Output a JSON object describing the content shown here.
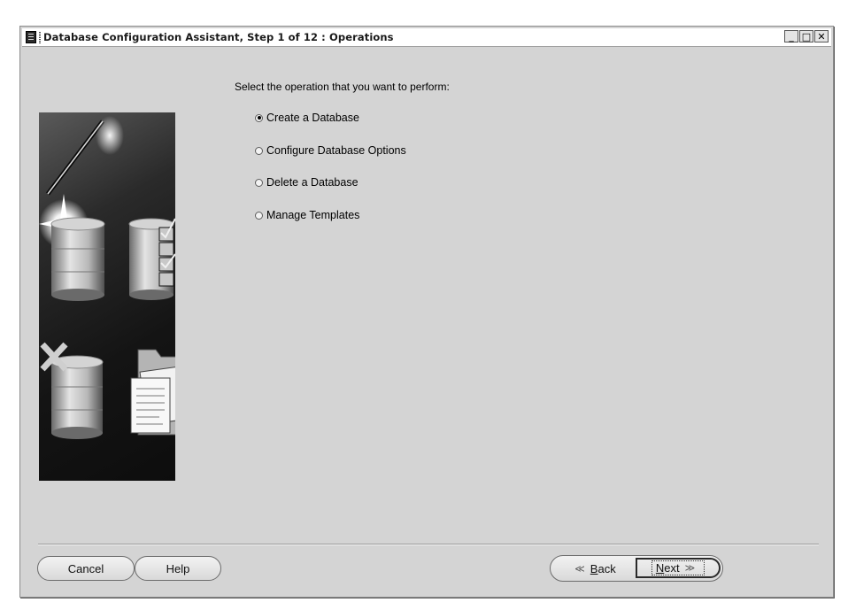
{
  "window": {
    "title": "Database Configuration Assistant, Step 1 of 12 : Operations",
    "controls": {
      "minimize": "_",
      "maximize": "□",
      "close": "✕"
    }
  },
  "main": {
    "prompt": "Select the operation that you want to perform:",
    "options": [
      {
        "label": "Create a Database",
        "selected": true
      },
      {
        "label": "Configure Database Options",
        "selected": false
      },
      {
        "label": "Delete a Database",
        "selected": false
      },
      {
        "label": "Manage Templates",
        "selected": false
      }
    ]
  },
  "buttons": {
    "cancel": "Cancel",
    "help": "Help",
    "back_mnemonic": "B",
    "back_rest": "ack",
    "next_mnemonic": "N",
    "next_rest": "ext"
  },
  "icons": {
    "app": "database-app-icon",
    "back_arrow": "double-chevron-left-icon",
    "next_arrow": "double-chevron-right-icon"
  }
}
